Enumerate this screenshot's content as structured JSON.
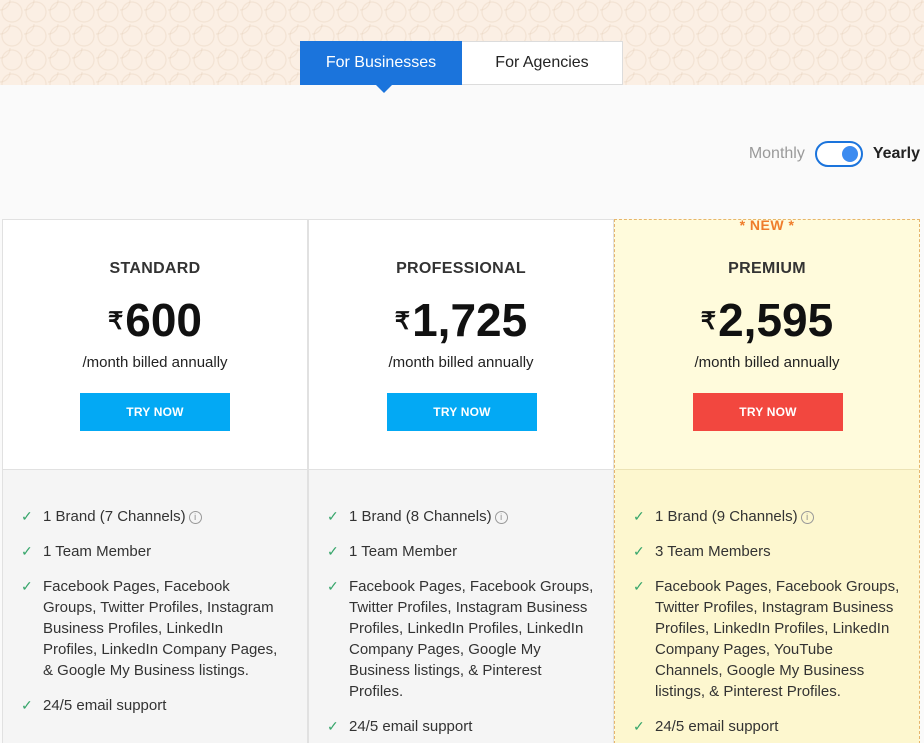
{
  "tabs": {
    "businesses": "For Businesses",
    "agencies": "For Agencies"
  },
  "billing": {
    "monthly": "Monthly",
    "yearly": "Yearly",
    "selected": "Yearly"
  },
  "colors": {
    "accent": "#1b74dc",
    "try_blue": "#03a9f4",
    "try_red": "#f2473f",
    "new_orange": "#ef7c2b",
    "check_green": "#37a66b"
  },
  "plans": [
    {
      "name": "STANDARD",
      "currency": "₹",
      "price": "600",
      "billed": "/month billed annually",
      "cta": "TRY NOW",
      "features": [
        "1 Brand (7 Channels)",
        "1 Team Member",
        "Facebook Pages, Facebook Groups, Twitter Profiles, Instagram Business Profiles, LinkedIn Profiles, LinkedIn Company Pages, & Google My Business listings.",
        "24/5 email support"
      ]
    },
    {
      "name": "PROFESSIONAL",
      "currency": "₹",
      "price": "1,725",
      "billed": "/month billed annually",
      "cta": "TRY NOW",
      "features": [
        "1 Brand (8 Channels)",
        "1 Team Member",
        "Facebook Pages, Facebook Groups, Twitter Profiles, Instagram Business Profiles, LinkedIn Profiles, LinkedIn Company Pages, Google My Business listings, & Pinterest Profiles.",
        "24/5 email support"
      ]
    },
    {
      "tag": "* NEW *",
      "name": "PREMIUM",
      "currency": "₹",
      "price": "2,595",
      "billed": "/month billed annually",
      "cta": "TRY NOW",
      "features": [
        "1 Brand (9 Channels)",
        "3 Team Members",
        "Facebook Pages, Facebook Groups, Twitter Profiles, Instagram Business Profiles, LinkedIn Profiles, LinkedIn Company Pages, YouTube Channels, Google My Business listings, & Pinterest Profiles.",
        "24/5 email support"
      ]
    }
  ]
}
